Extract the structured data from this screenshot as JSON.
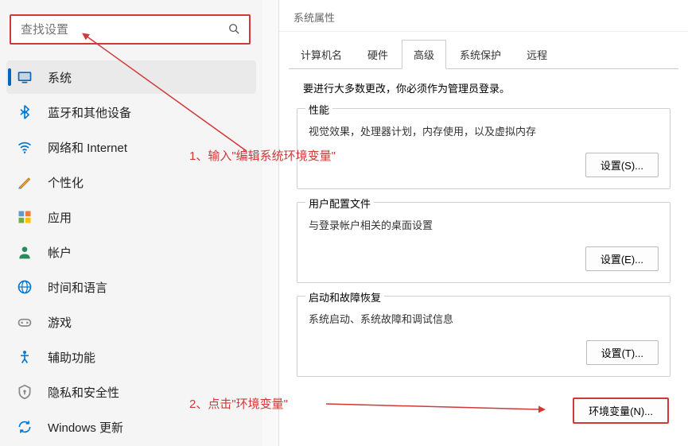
{
  "search": {
    "placeholder": "查找设置"
  },
  "nav": {
    "items": [
      {
        "label": "系统"
      },
      {
        "label": "蓝牙和其他设备"
      },
      {
        "label": "网络和 Internet"
      },
      {
        "label": "个性化"
      },
      {
        "label": "应用"
      },
      {
        "label": "帐户"
      },
      {
        "label": "时间和语言"
      },
      {
        "label": "游戏"
      },
      {
        "label": "辅助功能"
      },
      {
        "label": "隐私和安全性"
      },
      {
        "label": "Windows 更新"
      }
    ]
  },
  "dialog": {
    "title": "系统属性",
    "tabs": [
      {
        "label": "计算机名"
      },
      {
        "label": "硬件"
      },
      {
        "label": "高级"
      },
      {
        "label": "系统保护"
      },
      {
        "label": "远程"
      }
    ],
    "intro": "要进行大多数更改，你必须作为管理员登录。",
    "groups": {
      "performance": {
        "title": "性能",
        "desc": "视觉效果，处理器计划，内存使用，以及虚拟内存",
        "btn": "设置(S)..."
      },
      "userprofile": {
        "title": "用户配置文件",
        "desc": "与登录帐户相关的桌面设置",
        "btn": "设置(E)..."
      },
      "startup": {
        "title": "启动和故障恢复",
        "desc": "系统启动、系统故障和调试信息",
        "btn": "设置(T)..."
      }
    },
    "env_btn": "环境变量(N)..."
  },
  "annotations": {
    "step1": "1、输入\"编辑系统环境变量\"",
    "step2": "2、点击\"环境变量\""
  }
}
